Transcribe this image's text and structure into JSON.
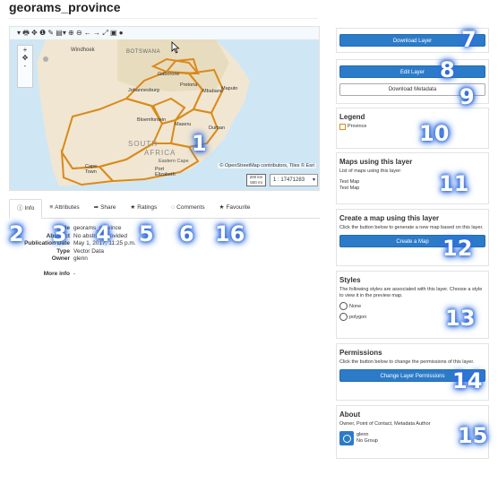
{
  "page": {
    "title": "georams_province"
  },
  "map": {
    "toolbar": "▾ 🖶 ✥ ❶ ✎ ▤▾ ⊕ ⊖ ← → ⤢ ▣ ●",
    "zoom_in": "+",
    "zoom_out": "-",
    "labels": {
      "windhoek": "Windhoek",
      "botswana": "BOTSWANA",
      "gaborone": "Gaborone",
      "pretoria": "Pretoria",
      "johannesburg": "Johannesburg",
      "maputo": "Maputo",
      "mbabane": "Mbabane",
      "bloemfontein": "Bloemfontein",
      "maseru": "Maseru",
      "durban": "Durban",
      "south": "SOUTH",
      "africa": "AFRICA",
      "cape_town": "Cape Town",
      "port_elizabeth": "Port Elizabeth",
      "eastern_cape": "Eastern Cape"
    },
    "attribution": "© OpenStreetMap contributors, Tiles © Esri",
    "scale_top": "200 km",
    "scale_bottom": "500 mi",
    "scale_value": "1 : 17471283",
    "scale_caret": "▾"
  },
  "tabs": [
    {
      "icon": "ⓘ",
      "label": "Info"
    },
    {
      "icon": "≡",
      "label": "Attributes"
    },
    {
      "icon": "➦",
      "label": "Share"
    },
    {
      "icon": "★",
      "label": "Ratings"
    },
    {
      "icon": "◌",
      "label": "Comments"
    },
    {
      "icon": "★",
      "label": "Favourite"
    }
  ],
  "info": {
    "rows": [
      {
        "key": "Title",
        "value": "georams_province"
      },
      {
        "key": "Abstract",
        "value": "No abstract provided"
      },
      {
        "key": "Publication Date",
        "value": "May 1, 2017, 11:25 p.m."
      },
      {
        "key": "Type",
        "value": "Vector Data"
      },
      {
        "key": "Owner",
        "value": "glenn"
      },
      {
        "key": "More info",
        "value": "-"
      }
    ]
  },
  "sidebar": {
    "download_layer": "Download Layer",
    "edit_layer": "Edit Layer",
    "download_metadata": "Download Metadata",
    "legend": {
      "title": "Legend",
      "item": "Province"
    },
    "maps_using": {
      "title": "Maps using this layer",
      "text": "List of maps using this layer:",
      "maps": [
        "Test Map",
        "Test Map"
      ]
    },
    "create_map": {
      "title": "Create a map using this layer",
      "text": "Click the button below to generate a new map based on this layer.",
      "button": "Create a Map"
    },
    "styles": {
      "title": "Styles",
      "text": "The following styles are associated with this layer. Choose a style to view it in the preview map.",
      "options": [
        "None",
        "polygon"
      ]
    },
    "permissions": {
      "title": "Permissions",
      "text": "Click the button below to change the permissions of this layer.",
      "button": "Change Layer Permissions"
    },
    "about": {
      "title": "About",
      "text": "Owner, Point of Contact, Metadata Author",
      "user": "glenn",
      "group": "No Group"
    }
  },
  "callouts": [
    "1",
    "2",
    "3",
    "4",
    "5",
    "6",
    "7",
    "8",
    "9",
    "10",
    "11",
    "12",
    "13",
    "14",
    "15",
    "16"
  ],
  "colors": {
    "primary": "#2c7bc9",
    "province_border": "#d98a1a",
    "callout_glow": "#2f6ad6"
  }
}
